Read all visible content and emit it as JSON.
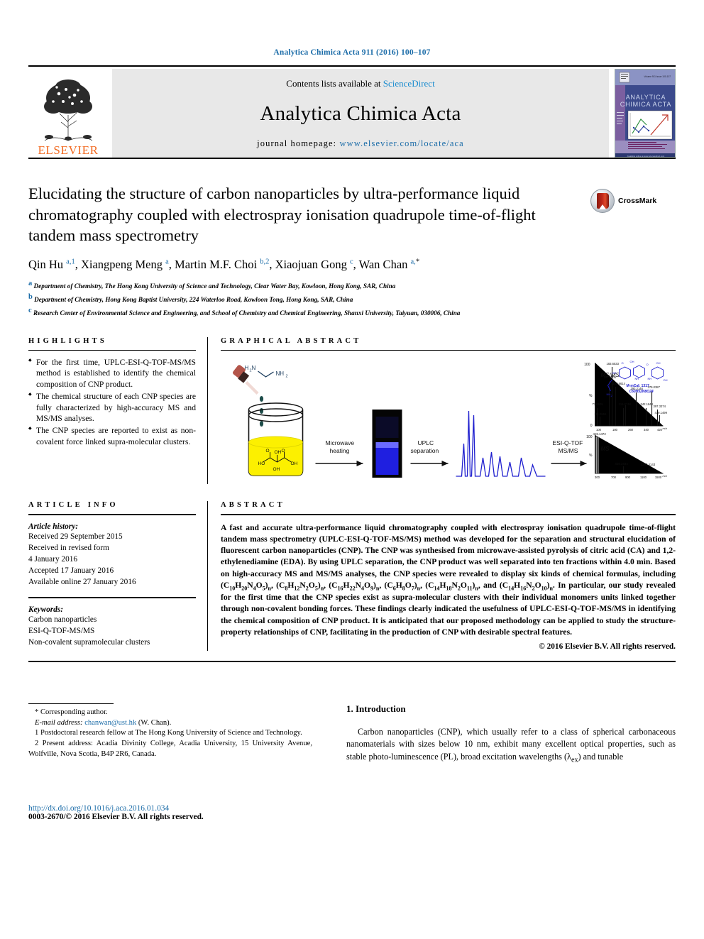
{
  "running_head": "Analytica Chimica Acta 911 (2016) 100–107",
  "masthead": {
    "publisher": "ELSEVIER",
    "contents_prefix": "Contents lists available at ",
    "contents_link": "ScienceDirect",
    "journal_title": "Analytica Chimica Acta",
    "homepage_prefix": "journal homepage: ",
    "homepage_url": "www.elsevier.com/locate/aca",
    "cover_title": "ANALYTICA CHIMICA ACTA"
  },
  "article": {
    "title": "Elucidating the structure of carbon nanoparticles by ultra-performance liquid chromatography coupled with electrospray ionisation quadrupole time-of-flight tandem mass spectrometry",
    "crossmark_label": "CrossMark",
    "authors_html": "Qin Hu <sup>a,1</sup>, Xiangpeng Meng <sup>a</sup>, Martin M.F. Choi <sup>b,2</sup>, Xiaojuan Gong <sup>c</sup>, Wan Chan <sup>a,</sup><sup class=\"star\">*</sup>",
    "affiliations": [
      {
        "mark": "a",
        "text": "Department of Chemistry, The Hong Kong University of Science and Technology, Clear Water Bay, Kowloon, Hong Kong, SAR, China"
      },
      {
        "mark": "b",
        "text": "Department of Chemistry, Hong Kong Baptist University, 224 Waterloo Road, Kowloon Tong, Hong Kong, SAR, China"
      },
      {
        "mark": "c",
        "text": "Research Center of Environmental Science and Engineering, and School of Chemistry and Chemical Engineering, Shanxi University, Taiyuan, 030006, China"
      }
    ]
  },
  "highlights": {
    "heading": "HIGHLIGHTS",
    "items": [
      "For the first time, UPLC-ESI-Q-TOF-MS/MS method is established to identify the chemical composition of CNP product.",
      "The chemical structure of each CNP species are fully characterized by high-accuracy MS and MS/MS analyses.",
      "The CNP species are reported to exist as non-covalent force linked supra-molecular clusters."
    ]
  },
  "graphical_abstract": {
    "heading": "GRAPHICAL ABSTRACT",
    "reagent_label_1": "H₂N",
    "reagent_label_2": "NH₂",
    "arrow_1_line1": "Microwave",
    "arrow_1_line2": "heating",
    "arrow_2_line1": "UPLC",
    "arrow_2_line2": "separation",
    "arrow_3_line1": "ESI-Q-TOF",
    "arrow_3_line2": "MS/MS",
    "msms_label": "MS/MS",
    "ms_label": "MS",
    "msms_axis_max": "100",
    "msms_axis_mid": "%",
    "msms_axis_zero": "0",
    "msms_peaks": [
      "71.0609",
      "111.0556",
      "162.6605",
      "183.6533",
      "190.6614",
      "215.0748",
      "293.2146",
      "342.1848",
      "379.0387",
      "397.3374",
      "419.1499"
    ],
    "msms_ticks": [
      "100",
      "180",
      "260",
      "340",
      "420"
    ],
    "msms_axis_unit": "m/z",
    "ms_peaks": [
      "419.1472",
      "839.2834",
      "1243.4143"
    ],
    "ms_ticks": [
      "300",
      "700",
      "900",
      "1100",
      "1500"
    ],
    "structure_mass": "M-mCal: 1317",
    "structure_formula": "C₆₀H₅₂N₈O₂₄"
  },
  "article_info": {
    "heading": "ARTICLE INFO",
    "history_label": "Article history:",
    "history": [
      "Received 29 September 2015",
      "Received in revised form",
      "4 January 2016",
      "Accepted 17 January 2016",
      "Available online 27 January 2016"
    ],
    "keywords_label": "Keywords:",
    "keywords": [
      "Carbon nanoparticles",
      "ESI-Q-TOF-MS/MS",
      "Non-covalent supramolecular clusters"
    ]
  },
  "abstract": {
    "heading": "ABSTRACT",
    "body_html": "A fast and accurate ultra-performance liquid chromatography coupled with electrospray ionisation quadrupole time-of-flight tandem mass spectrometry (UPLC-ESI-Q-TOF-MS/MS) method was developed for the separation and structural elucidation of fluorescent carbon nanoparticles (CNP). The CNP was synthesised from microwave-assisted pyrolysis of citric acid (CA) and 1,2-ethylenediamine (EDA). By using UPLC separation, the CNP product was well separated into ten fractions within 4.0 min. Based on high-accuracy MS and MS/MS analyses, the CNP species were revealed to display six kinds of chemical formulas, including (C<sub>10</sub>H<sub>20</sub>N<sub>4</sub>O<sub>5</sub>)<sub>n</sub>, (C<sub>8</sub>H<sub>12</sub>N<sub>2</sub>O<sub>5</sub>)<sub>n</sub>, (C<sub>16</sub>H<sub>22</sub>N<sub>4</sub>O<sub>9</sub>)<sub>n</sub>, (C<sub>6</sub>H<sub>8</sub>O<sub>7</sub>)<sub>n</sub>, (C<sub>14</sub>H<sub>18</sub>N<sub>2</sub>O<sub>11</sub>)<sub>n</sub>, and (C<sub>14</sub>H<sub>16</sub>N<sub>2</sub>O<sub>10</sub>)<sub>n</sub>. In particular, our study revealed for the first time that the CNP species exist as supra-molecular clusters with their individual monomers units linked together through non-covalent bonding forces. These findings clearly indicated the usefulness of UPLC-ESI-Q-TOF-MS/MS in identifying the chemical composition of CNP product. It is anticipated that our proposed methodology can be applied to study the structure-property relationships of CNP, facilitating in the production of CNP with desirable spectral features.",
    "copyright": "© 2016 Elsevier B.V. All rights reserved."
  },
  "footnotes": {
    "corresponding": "* Corresponding author.",
    "email_label": "E-mail address:",
    "email": "chanwan@ust.hk",
    "email_suffix": "(W. Chan).",
    "note1": "1  Postdoctoral research fellow at The Hong Kong University of Science and Technology.",
    "note2": "2  Present address: Acadia Divinity College, Acadia University, 15 University Avenue, Wolfville, Nova Scotia, B4P 2R6, Canada."
  },
  "footer": {
    "doi": "http://dx.doi.org/10.1016/j.aca.2016.01.034",
    "issn": "0003-2670/© 2016 Elsevier B.V. All rights reserved."
  },
  "introduction": {
    "heading": "1.  Introduction",
    "paragraph_html": "Carbon nanoparticles (CNP), which usually refer to a class of spherical carbonaceous nanomaterials with sizes below 10 nm, exhibit many excellent optical properties, such as stable photo-luminescence (PL), broad excitation wavelengths (λ<sub>ex</sub>) and tunable"
  },
  "colors": {
    "link_blue": "#1b6ca8",
    "sciencedirect_blue": "#1b8ccf",
    "elsevier_orange": "#f26a21",
    "masthead_gray": "#e8e8e8",
    "spectrum_blue": "#2020cf",
    "solution_yellow": "#fcf000"
  }
}
